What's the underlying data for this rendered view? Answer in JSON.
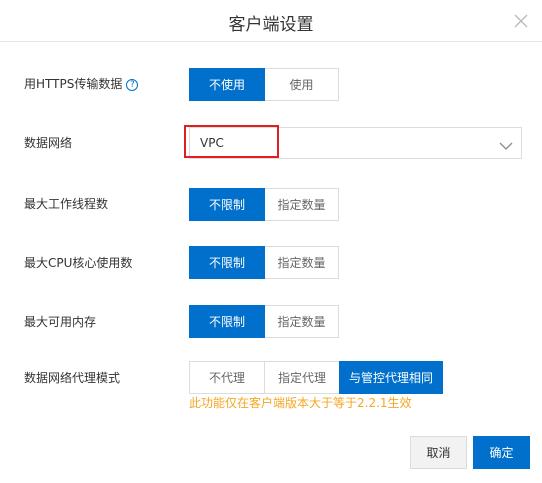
{
  "dialog": {
    "title": "客户端设置",
    "close_icon": "close-icon"
  },
  "https": {
    "label": "用HTTPS传输数据",
    "help_glyph": "?",
    "options": [
      "不使用",
      "使用"
    ],
    "selected": "不使用"
  },
  "network": {
    "label": "数据网络",
    "value": "VPC"
  },
  "max_threads": {
    "label": "最大工作线程数",
    "options": [
      "不限制",
      "指定数量"
    ],
    "selected": "不限制"
  },
  "max_cpu": {
    "label": "最大CPU核心使用数",
    "options": [
      "不限制",
      "指定数量"
    ],
    "selected": "不限制"
  },
  "max_memory": {
    "label": "最大可用内存",
    "options": [
      "不限制",
      "指定数量"
    ],
    "selected": "不限制"
  },
  "proxy_mode": {
    "label": "数据网络代理模式",
    "options": [
      "不代理",
      "指定代理",
      "与管控代理相同"
    ],
    "selected": "与管控代理相同",
    "note": "此功能仅在客户端版本大于等于2.2.1生效"
  },
  "footer": {
    "cancel_label": "取消",
    "ok_label": "确定"
  },
  "colors": {
    "primary": "#0070cc",
    "note": "#f5a623",
    "highlight": "#e02020"
  }
}
